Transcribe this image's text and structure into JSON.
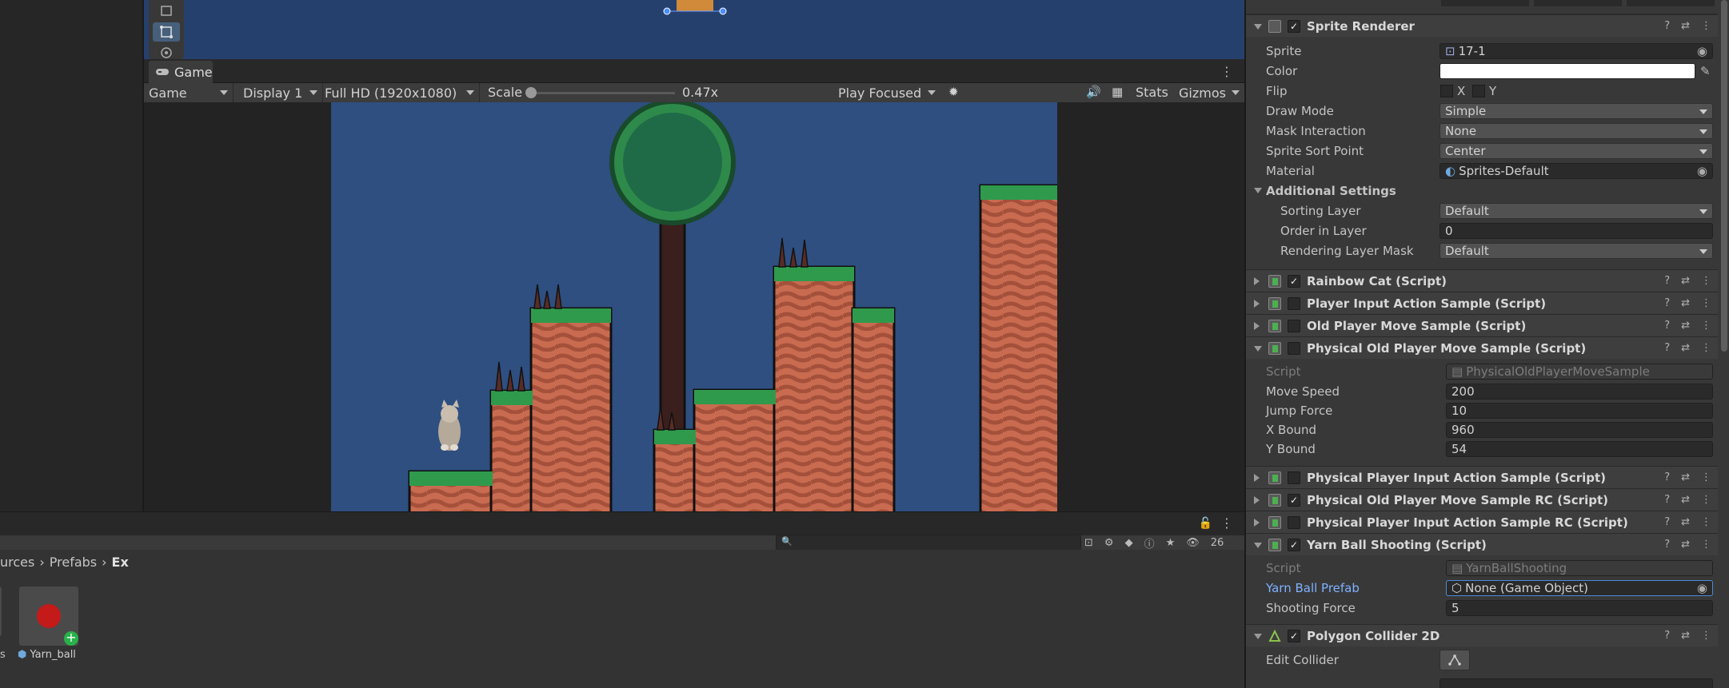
{
  "game_view": {
    "tab_label": "Game",
    "toolbar": {
      "game_dropdown": "Game",
      "display_dropdown": "Display 1",
      "resolution_dropdown": "Full HD (1920x1080)",
      "scale_label": "Scale",
      "scale_value": "0.47x",
      "play_mode_dropdown": "Play Focused",
      "stats_label": "Stats",
      "gizmos_label": "Gizmos"
    }
  },
  "project": {
    "breadcrumb": [
      "urces",
      "Prefabs",
      "Ex"
    ],
    "hidden_count": "26",
    "assets": [
      {
        "label": "s"
      },
      {
        "label": "Yarn_ball"
      }
    ]
  },
  "inspector": {
    "sprite_renderer": {
      "title": "Sprite Renderer",
      "enabled": true,
      "sprite_label": "Sprite",
      "sprite_value": "17-1",
      "color_label": "Color",
      "flip_label": "Flip",
      "flip_x": "X",
      "flip_y": "Y",
      "draw_mode_label": "Draw Mode",
      "draw_mode_value": "Simple",
      "mask_label": "Mask Interaction",
      "mask_value": "None",
      "sort_point_label": "Sprite Sort Point",
      "sort_point_value": "Center",
      "material_label": "Material",
      "material_value": "Sprites-Default",
      "additional_label": "Additional Settings",
      "sorting_layer_label": "Sorting Layer",
      "sorting_layer_value": "Default",
      "order_label": "Order in Layer",
      "order_value": "0",
      "render_mask_label": "Rendering Layer Mask",
      "render_mask_value": "Default"
    },
    "collapsed_components_a": [
      {
        "title": "Rainbow Cat (Script)",
        "enabled": true
      },
      {
        "title": "Player Input Action Sample (Script)",
        "enabled": false
      },
      {
        "title": "Old Player Move Sample (Script)",
        "enabled": false
      }
    ],
    "physical_old_move": {
      "title": "Physical Old Player Move Sample (Script)",
      "enabled": false,
      "script_label": "Script",
      "script_value": "PhysicalOldPlayerMoveSample",
      "move_speed_label": "Move Speed",
      "move_speed_value": "200",
      "jump_force_label": "Jump Force",
      "jump_force_value": "10",
      "x_bound_label": "X Bound",
      "x_bound_value": "960",
      "y_bound_label": "Y Bound",
      "y_bound_value": "54"
    },
    "collapsed_components_b": [
      {
        "title": "Physical Player Input Action Sample (Script)",
        "enabled": false
      },
      {
        "title": "Physical Old Player Move Sample RC (Script)",
        "enabled": true
      },
      {
        "title": "Physical Player Input Action Sample RC (Script)",
        "enabled": false
      }
    ],
    "yarn_ball_shooting": {
      "title": "Yarn Ball Shooting (Script)",
      "enabled": true,
      "script_label": "Script",
      "script_value": "YarnBallShooting",
      "prefab_label": "Yarn Ball Prefab",
      "prefab_value": "None (Game Object)",
      "force_label": "Shooting Force",
      "force_value": "5"
    },
    "polygon_collider": {
      "title": "Polygon Collider 2D",
      "enabled": true,
      "edit_label": "Edit Collider"
    }
  }
}
